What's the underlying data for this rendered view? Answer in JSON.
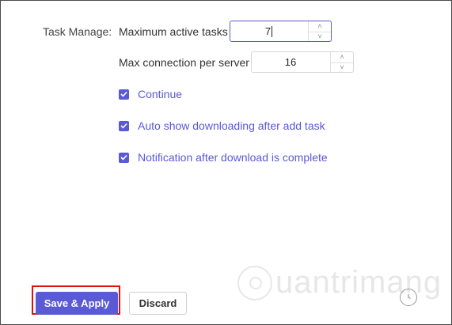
{
  "task_manage": {
    "section_label": "Task Manage:",
    "max_active_tasks": {
      "label": "Maximum active tasks",
      "value": "7"
    },
    "max_connection": {
      "label": "Max connection per server",
      "value": "16"
    },
    "options": [
      {
        "label": "Continue",
        "checked": true
      },
      {
        "label": "Auto show downloading after add task",
        "checked": true
      },
      {
        "label": "Notification after download is complete",
        "checked": true
      }
    ]
  },
  "footer": {
    "save_label": "Save & Apply",
    "discard_label": "Discard"
  },
  "watermark": {
    "text": "uantrimang"
  },
  "colors": {
    "accent": "#5a59d6",
    "highlight_border": "#e01010"
  },
  "icons": {
    "checkbox": "checkmark-icon",
    "spin_up": "chevron-up-icon",
    "spin_down": "chevron-down-icon",
    "corner": "clock-icon"
  }
}
